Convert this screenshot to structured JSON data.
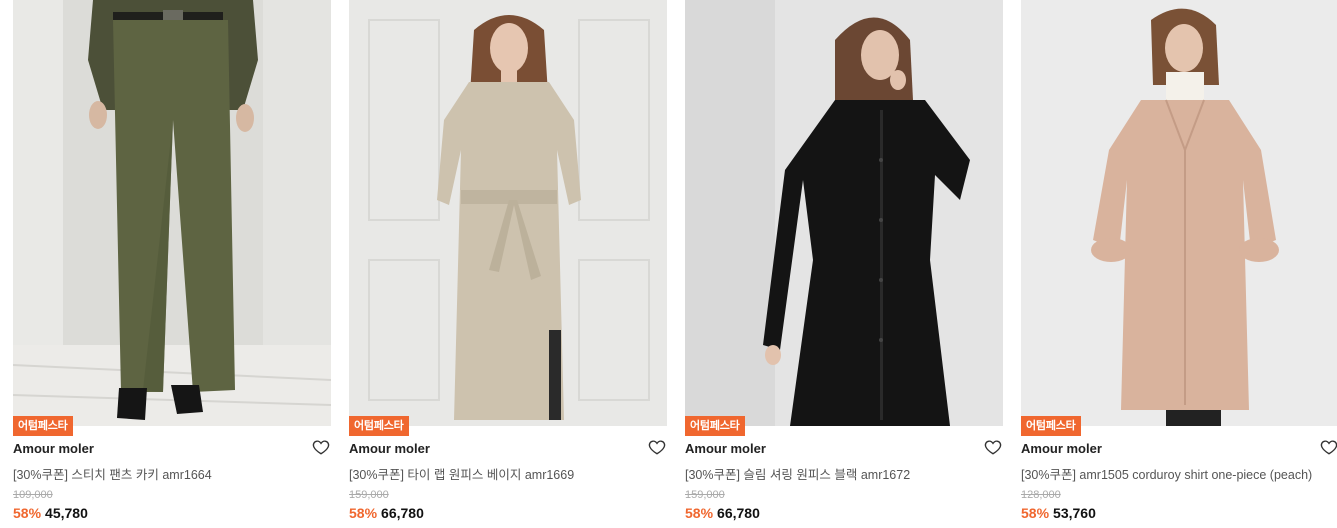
{
  "accent_color": "#f0672f",
  "products": [
    {
      "badge": "어텀페스타",
      "brand": "Amour moler",
      "title": "[30%쿠폰] 스티치 팬츠 카키 amr1664",
      "original_price": "109,000",
      "discount": "58%",
      "sale_price": "45,780",
      "wishlist_icon": "heart-outline-icon"
    },
    {
      "badge": "어텀페스타",
      "brand": "Amour moler",
      "title": "[30%쿠폰] 타이 랩 원피스 베이지 amr1669",
      "original_price": "159,000",
      "discount": "58%",
      "sale_price": "66,780",
      "wishlist_icon": "heart-outline-icon"
    },
    {
      "badge": "어텀페스타",
      "brand": "Amour moler",
      "title": "[30%쿠폰] 슬림 셔링 원피스 블랙 amr1672",
      "original_price": "159,000",
      "discount": "58%",
      "sale_price": "66,780",
      "wishlist_icon": "heart-outline-icon"
    },
    {
      "badge": "어텀페스타",
      "brand": "Amour moler",
      "title": "[30%쿠폰] amr1505 corduroy shirt one-piece (peach)",
      "original_price": "128,000",
      "discount": "58%",
      "sale_price": "53,760",
      "wishlist_icon": "heart-outline-icon"
    }
  ]
}
